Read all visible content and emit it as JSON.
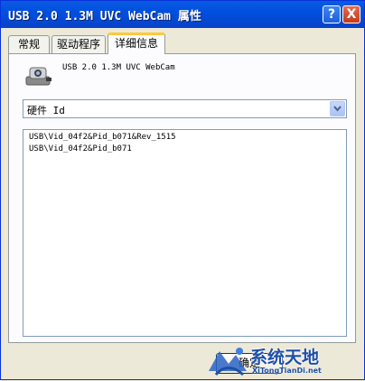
{
  "window": {
    "title": "USB 2.0 1.3M UVC WebCam 属性",
    "help_button": "?",
    "close_button": "X"
  },
  "tabs": [
    {
      "label": "常规"
    },
    {
      "label": "驱动程序"
    },
    {
      "label": "详细信息",
      "selected": true
    }
  ],
  "device": {
    "icon": "webcam-icon",
    "name": "USB 2.0 1.3M UVC WebCam"
  },
  "property_select": {
    "selected": "硬件 Id"
  },
  "values": [
    "USB\\Vid_04f2&Pid_b071&Rev_1515",
    "USB\\Vid_04f2&Pid_b071"
  ],
  "buttons": {
    "ok_partial": "确定"
  },
  "watermark": {
    "title": "系统天地",
    "url": "XiTongTianDi.net"
  },
  "colors": {
    "titlebar": "#0a5be0",
    "selected_tab_accent": "#ffc83c",
    "watermark_blue": "#1e4fa8"
  }
}
